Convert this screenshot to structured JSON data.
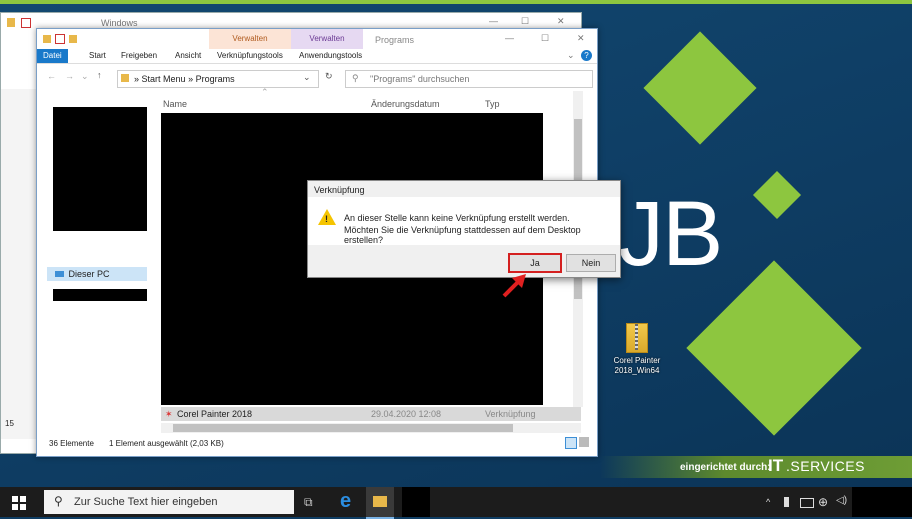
{
  "back_window": {
    "title": "Windows"
  },
  "explorer": {
    "title": "Programs",
    "context_tabs": [
      {
        "label": "Verwalten",
        "color": "#fce4d6"
      },
      {
        "label": "Verwalten",
        "color": "#e6d9f2"
      }
    ],
    "ribbon_tabs": [
      "Datei",
      "Start",
      "Freigeben",
      "Ansicht",
      "Verknüpfungstools",
      "Anwendungstools"
    ],
    "breadcrumb": {
      "sep": "»",
      "items": [
        "Start Menu",
        "Programs"
      ]
    },
    "search_placeholder": "\"Programs\" durchsuchen",
    "columns": [
      "Name",
      "Änderungsdatum",
      "Typ"
    ],
    "nav_items": [
      {
        "label": "Dieser PC",
        "icon": "computer-icon"
      }
    ],
    "selected_row": {
      "name": "Corel Painter 2018",
      "date": "29.04.2020 12:08",
      "type": "Verknüpfung"
    },
    "status": {
      "count": "36 Elemente",
      "selection": "1 Element ausgewählt (2,03 KB)"
    },
    "side_number": "15"
  },
  "dialog": {
    "title": "Verknüpfung",
    "line1": "An dieser Stelle kann keine Verknüpfung erstellt werden.",
    "line2": "Möchten Sie die Verknüpfung stattdessen auf dem Desktop erstellen?",
    "yes": "Ja",
    "no": "Nein"
  },
  "desktop": {
    "big_text": "JB",
    "icon_label_1": "Corel Painter",
    "icon_label_2": "2018_Win64",
    "brand_prefix": "eingerichtet durch:",
    "brand_it": "IT",
    "brand_services": ".SERVICES",
    "accent": "#8dc63f"
  },
  "taskbar": {
    "search_placeholder": "Zur Suche Text hier eingeben"
  }
}
